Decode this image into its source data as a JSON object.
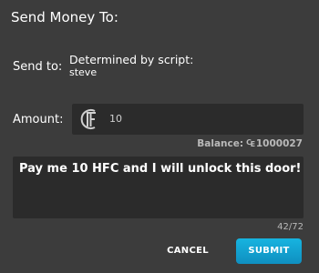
{
  "dialog": {
    "title": "Send Money To:"
  },
  "send_to": {
    "label": "Send to:",
    "recipient_line1": "Determined by script:",
    "recipient_line2": "steve"
  },
  "amount": {
    "label": "Amount:",
    "value": "10",
    "currency_icon": "hfc-logo-icon"
  },
  "balance": {
    "label": "Balance:",
    "coin_glyph": "₠",
    "value": "1000027"
  },
  "message": {
    "text": "Pay me 10 HFC and I will unlock this door!",
    "char_count": "42/72"
  },
  "buttons": {
    "cancel_label": "CANCEL",
    "submit_label": "SUBMIT"
  },
  "colors": {
    "background": "#3c3c3c",
    "field_background": "#2b2b2b",
    "submit_accent": "#17b4e0",
    "muted_text": "#b9b9b9"
  }
}
